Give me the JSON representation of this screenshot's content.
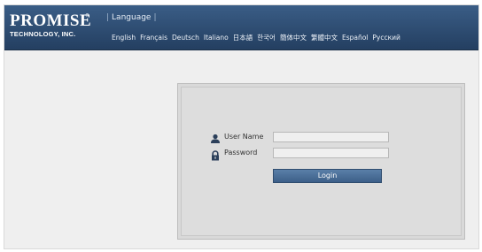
{
  "header": {
    "logo": {
      "main": "PROMISE",
      "trademark": "®",
      "sub": "TECHNOLOGY, INC."
    },
    "language_title": "Language",
    "languages": [
      "English",
      "Français",
      "Deutsch",
      "Italiano",
      "日本語",
      "한국어",
      "簡体中文",
      "繁體中文",
      "Español",
      "Русский"
    ]
  },
  "login": {
    "username_label": "User Name",
    "username_value": "",
    "password_label": "Password",
    "password_value": "",
    "button_label": "Login"
  },
  "icons": {
    "user": "user-icon",
    "password": "lock-icon"
  },
  "colors": {
    "header": "#2f4f75",
    "button": "#4a6f98",
    "page": "#efefef",
    "panel": "#dddddd"
  }
}
